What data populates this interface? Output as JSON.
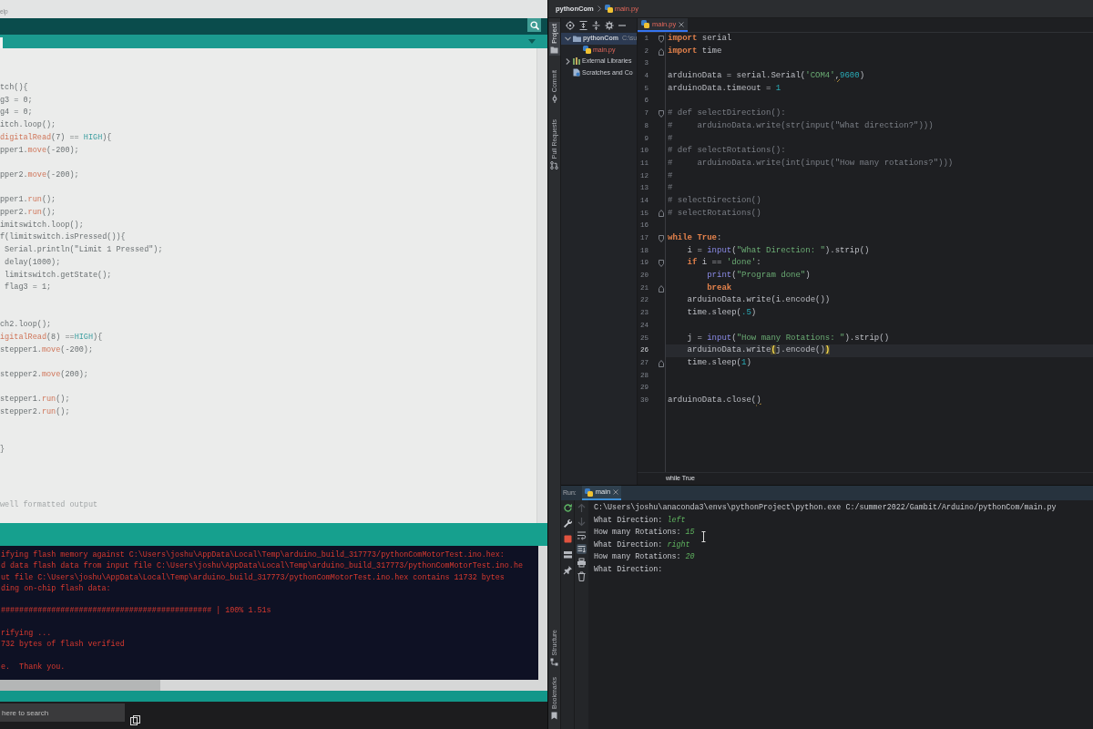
{
  "arduino_ide": {
    "menu": [
      "elp"
    ],
    "code_lines": [
      {
        "kind": "code",
        "tokens": [
          {
            "text": "tch(){",
            "kind": "plain"
          }
        ]
      },
      {
        "kind": "code",
        "tokens": [
          {
            "text": "g3 = 0;",
            "kind": "plain"
          }
        ]
      },
      {
        "kind": "code",
        "tokens": [
          {
            "text": "g4 = 0;",
            "kind": "plain"
          }
        ]
      },
      {
        "kind": "code",
        "tokens": [
          {
            "text": "itch.loop();",
            "kind": "plain"
          }
        ]
      },
      {
        "kind": "code",
        "tokens": [
          {
            "text": "digitalRead",
            "kind": "function"
          },
          {
            "text": "(7) == ",
            "kind": "plain"
          },
          {
            "text": "HIGH",
            "kind": "constant"
          },
          {
            "text": "){",
            "kind": "plain"
          }
        ]
      },
      {
        "kind": "code",
        "tokens": [
          {
            "text": "pper1.",
            "kind": "plain"
          },
          {
            "text": "move",
            "kind": "function"
          },
          {
            "text": "(-200);",
            "kind": "plain"
          }
        ]
      },
      {
        "kind": "blank"
      },
      {
        "kind": "code",
        "tokens": [
          {
            "text": "pper2.",
            "kind": "plain"
          },
          {
            "text": "move",
            "kind": "function"
          },
          {
            "text": "(-200);",
            "kind": "plain"
          }
        ]
      },
      {
        "kind": "blank"
      },
      {
        "kind": "code",
        "tokens": [
          {
            "text": "pper1.",
            "kind": "plain"
          },
          {
            "text": "run",
            "kind": "function"
          },
          {
            "text": "();",
            "kind": "plain"
          }
        ]
      },
      {
        "kind": "code",
        "tokens": [
          {
            "text": "pper2.",
            "kind": "plain"
          },
          {
            "text": "run",
            "kind": "function"
          },
          {
            "text": "();",
            "kind": "plain"
          }
        ]
      },
      {
        "kind": "code",
        "tokens": [
          {
            "text": "imitswitch.loop();",
            "kind": "plain"
          }
        ]
      },
      {
        "kind": "code",
        "tokens": [
          {
            "text": "f(limitswitch.isPressed()){",
            "kind": "plain"
          }
        ]
      },
      {
        "kind": "code",
        "tokens": [
          {
            "text": " Serial.println(\"Limit 1 Pressed\");",
            "kind": "plain"
          }
        ]
      },
      {
        "kind": "code",
        "tokens": [
          {
            "text": " delay(1000);",
            "kind": "plain"
          }
        ]
      },
      {
        "kind": "code",
        "tokens": [
          {
            "text": " limitswitch.getState();",
            "kind": "plain"
          }
        ]
      },
      {
        "kind": "code",
        "tokens": [
          {
            "text": " flag3 = 1;",
            "kind": "plain"
          }
        ]
      },
      {
        "kind": "blank"
      },
      {
        "kind": "blank"
      },
      {
        "kind": "code",
        "tokens": [
          {
            "text": "ch2.loop();",
            "kind": "plain"
          }
        ]
      },
      {
        "kind": "code",
        "tokens": [
          {
            "text": "igitalRead",
            "kind": "function"
          },
          {
            "text": "(8) ==",
            "kind": "plain"
          },
          {
            "text": "HIGH",
            "kind": "constant"
          },
          {
            "text": "){",
            "kind": "plain"
          }
        ]
      },
      {
        "kind": "code",
        "tokens": [
          {
            "text": "stepper1.",
            "kind": "plain"
          },
          {
            "text": "move",
            "kind": "function"
          },
          {
            "text": "(-200);",
            "kind": "plain"
          }
        ]
      },
      {
        "kind": "blank"
      },
      {
        "kind": "code",
        "tokens": [
          {
            "text": "stepper2.",
            "kind": "plain"
          },
          {
            "text": "move",
            "kind": "function"
          },
          {
            "text": "(200);",
            "kind": "plain"
          }
        ]
      },
      {
        "kind": "blank"
      },
      {
        "kind": "code",
        "tokens": [
          {
            "text": "stepper1.",
            "kind": "plain"
          },
          {
            "text": "run",
            "kind": "function"
          },
          {
            "text": "();",
            "kind": "plain"
          }
        ]
      },
      {
        "kind": "code",
        "tokens": [
          {
            "text": "stepper2.",
            "kind": "plain"
          },
          {
            "text": "run",
            "kind": "function"
          },
          {
            "text": "();",
            "kind": "plain"
          }
        ]
      },
      {
        "kind": "blank"
      },
      {
        "kind": "blank"
      },
      {
        "kind": "code",
        "tokens": [
          {
            "text": "}",
            "kind": "plain"
          }
        ]
      }
    ],
    "message": "well formatted output",
    "console_lines": [
      {
        "kind": "text",
        "text": "ifying flash memory against C:\\Users\\joshu\\AppData\\Local\\Temp\\arduino_build_317773/pythonComMotorTest.ino.hex:"
      },
      {
        "kind": "text",
        "text": "d data flash data from input file C:\\Users\\joshu\\AppData\\Local\\Temp\\arduino_build_317773/pythonComMotorTest.ino.he"
      },
      {
        "kind": "text",
        "text": "ut file C:\\Users\\joshu\\AppData\\Local\\Temp\\arduino_build_317773/pythonComMotorTest.ino.hex contains 11732 bytes"
      },
      {
        "kind": "text",
        "text": "ding on-chip flash data:"
      },
      {
        "kind": "blank"
      },
      {
        "kind": "text",
        "text": "############################################## | 100% 1.51s"
      },
      {
        "kind": "blank"
      },
      {
        "kind": "text",
        "text": "rifying ..."
      },
      {
        "kind": "text",
        "text": "732 bytes of flash verified"
      },
      {
        "kind": "blank"
      },
      {
        "kind": "text",
        "text": "e.  Thank you."
      }
    ]
  },
  "taskbar": {
    "search": {
      "placeholder": "here to search"
    }
  },
  "pycharm": {
    "breadcrumbs": [
      {
        "label": "pythonCom",
        "kind": "project"
      },
      {
        "label": "main.py",
        "kind": "python_file",
        "unversioned": true
      }
    ],
    "tool_stripe_top": [
      {
        "label": "Project",
        "selected": true
      },
      {
        "label": "Commit",
        "selected": false
      },
      {
        "label": "Pull Requests",
        "selected": false
      }
    ],
    "tool_stripe_bottom": [
      {
        "label": "Structure",
        "selected": false
      },
      {
        "label": "Bookmarks",
        "selected": false
      }
    ],
    "project_tree": [
      {
        "label": "pythonCom",
        "hint": "C:\\su",
        "kind": "folder",
        "expanded": true,
        "selected": true,
        "children": [
          {
            "label": "main.py",
            "kind": "python_file",
            "unversioned": true,
            "selected": false
          }
        ]
      },
      {
        "label": "External Libraries",
        "kind": "library",
        "expanded": false,
        "selected": false
      },
      {
        "label": "Scratches and Co",
        "kind": "scratches",
        "selected": false
      }
    ],
    "editor": {
      "tabs": [
        {
          "label": "main.py",
          "selected": true,
          "unversioned": true
        }
      ],
      "lines": [
        {
          "number": "1",
          "current": false,
          "kind": "fold_start",
          "tokens": [
            {
              "text": "import",
              "kind": "keyword"
            },
            {
              "text": " serial",
              "kind": "plain"
            }
          ]
        },
        {
          "number": "2",
          "current": false,
          "kind": "fold_end",
          "tokens": [
            {
              "text": "import",
              "kind": "keyword"
            },
            {
              "text": " time",
              "kind": "plain"
            }
          ]
        },
        {
          "number": "3",
          "current": false,
          "kind": "plain"
        },
        {
          "number": "4",
          "current": false,
          "kind": "plain",
          "tokens": [
            {
              "text": "arduinoData = serial.Serial(",
              "kind": "plain"
            },
            {
              "text": "'COM4'",
              "kind": "string"
            },
            {
              "text": ",",
              "kind": "warn"
            },
            {
              "text": "9600",
              "kind": "number"
            },
            {
              "text": ")",
              "kind": "plain"
            }
          ]
        },
        {
          "number": "5",
          "current": false,
          "kind": "plain",
          "tokens": [
            {
              "text": "arduinoData.timeout = ",
              "kind": "plain"
            },
            {
              "text": "1",
              "kind": "number"
            }
          ]
        },
        {
          "number": "6",
          "current": false,
          "kind": "plain"
        },
        {
          "number": "7",
          "current": false,
          "kind": "fold_start",
          "tokens": [
            {
              "text": "# def selectDirection():",
              "kind": "comment"
            }
          ]
        },
        {
          "number": "8",
          "current": false,
          "kind": "plain",
          "tokens": [
            {
              "text": "#     arduinoData.write(str(input(\"What direction?\")))",
              "kind": "comment"
            }
          ]
        },
        {
          "number": "9",
          "current": false,
          "kind": "plain",
          "tokens": [
            {
              "text": "#",
              "kind": "comment"
            }
          ]
        },
        {
          "number": "10",
          "current": false,
          "kind": "plain",
          "tokens": [
            {
              "text": "# def selectRotations():",
              "kind": "comment"
            }
          ]
        },
        {
          "number": "11",
          "current": false,
          "kind": "plain",
          "tokens": [
            {
              "text": "#     arduinoData.write(int(input(\"How many rotations?\")))",
              "kind": "comment"
            }
          ]
        },
        {
          "number": "12",
          "current": false,
          "kind": "plain",
          "tokens": [
            {
              "text": "#",
              "kind": "comment"
            }
          ]
        },
        {
          "number": "13",
          "current": false,
          "kind": "plain",
          "tokens": [
            {
              "text": "#",
              "kind": "comment"
            }
          ]
        },
        {
          "number": "14",
          "current": false,
          "kind": "plain",
          "tokens": [
            {
              "text": "# selectDirection()",
              "kind": "comment"
            }
          ]
        },
        {
          "number": "15",
          "current": false,
          "kind": "fold_end",
          "tokens": [
            {
              "text": "# selectRotations()",
              "kind": "comment"
            }
          ]
        },
        {
          "number": "16",
          "current": false,
          "kind": "plain"
        },
        {
          "number": "17",
          "current": false,
          "kind": "fold_start",
          "tokens": [
            {
              "text": "while True",
              "kind": "keyword"
            },
            {
              "text": ":",
              "kind": "plain"
            }
          ]
        },
        {
          "number": "18",
          "current": false,
          "kind": "plain",
          "tokens": [
            {
              "text": "    i = ",
              "kind": "plain"
            },
            {
              "text": "input",
              "kind": "builtin"
            },
            {
              "text": "(",
              "kind": "plain"
            },
            {
              "text": "\"What Direction: \"",
              "kind": "string"
            },
            {
              "text": ").strip()",
              "kind": "plain"
            }
          ]
        },
        {
          "number": "19",
          "current": false,
          "kind": "fold_start",
          "tokens": [
            {
              "text": "    if",
              "kind": "keyword"
            },
            {
              "text": " i == ",
              "kind": "plain"
            },
            {
              "text": "'done'",
              "kind": "string"
            },
            {
              "text": ":",
              "kind": "plain"
            }
          ]
        },
        {
          "number": "20",
          "current": false,
          "kind": "plain",
          "tokens": [
            {
              "text": "        print",
              "kind": "builtin"
            },
            {
              "text": "(",
              "kind": "plain"
            },
            {
              "text": "\"Program done\"",
              "kind": "string"
            },
            {
              "text": ")",
              "kind": "plain"
            }
          ]
        },
        {
          "number": "21",
          "current": false,
          "kind": "fold_end",
          "tokens": [
            {
              "text": "        break",
              "kind": "keyword"
            }
          ]
        },
        {
          "number": "22",
          "current": false,
          "kind": "plain",
          "tokens": [
            {
              "text": "    arduinoData.write(i.encode())",
              "kind": "plain"
            }
          ]
        },
        {
          "number": "23",
          "current": false,
          "kind": "plain",
          "tokens": [
            {
              "text": "    time.sleep(",
              "kind": "plain"
            },
            {
              "text": ".5",
              "kind": "number"
            },
            {
              "text": ")",
              "kind": "plain"
            }
          ]
        },
        {
          "number": "24",
          "current": false,
          "kind": "plain"
        },
        {
          "number": "25",
          "current": false,
          "kind": "plain",
          "tokens": [
            {
              "text": "    j = ",
              "kind": "plain"
            },
            {
              "text": "input",
              "kind": "builtin"
            },
            {
              "text": "(",
              "kind": "plain"
            },
            {
              "text": "\"How many Rotations: \"",
              "kind": "string"
            },
            {
              "text": ").strip()",
              "kind": "plain"
            }
          ]
        },
        {
          "number": "26",
          "current": true,
          "kind": "plain",
          "tokens": [
            {
              "text": "    arduinoData.write",
              "kind": "plain"
            },
            {
              "text": "(",
              "kind": "match"
            },
            {
              "text": "j.encode()",
              "kind": "plain"
            },
            {
              "text": ")",
              "kind": "match"
            }
          ]
        },
        {
          "number": "27",
          "current": false,
          "kind": "fold_end",
          "tokens": [
            {
              "text": "    time.sleep(",
              "kind": "plain"
            },
            {
              "text": "1",
              "kind": "number"
            },
            {
              "text": ")",
              "kind": "plain"
            }
          ]
        },
        {
          "number": "28",
          "current": false,
          "kind": "plain"
        },
        {
          "number": "29",
          "current": false,
          "kind": "plain"
        },
        {
          "number": "30",
          "current": false,
          "kind": "plain",
          "tokens": [
            {
              "text": "arduinoData.close(",
              "kind": "plain"
            },
            {
              "text": ")",
              "kind": "warn"
            }
          ]
        }
      ],
      "breadcrumb": "while True"
    },
    "run": {
      "label": "Run:",
      "tabs": [
        {
          "label": "main",
          "selected": true
        }
      ],
      "left_toolbar": [
        {
          "disabled": false,
          "on": false
        },
        {
          "disabled": false,
          "on": false
        },
        {
          "disabled": false,
          "on": false
        },
        {
          "disabled": false,
          "on": false
        },
        {
          "disabled": false,
          "on": false
        }
      ],
      "right_toolbar": [
        {
          "disabled": true,
          "on": false
        },
        {
          "disabled": true,
          "on": false
        },
        {
          "disabled": false,
          "on": false
        },
        {
          "disabled": false,
          "on": true
        },
        {
          "disabled": false,
          "on": false
        },
        {
          "disabled": false,
          "on": false
        }
      ],
      "console": [
        {
          "segments": [
            {
              "text": "C:\\Users\\joshu\\anaconda3\\envs\\pythonProject\\python.exe C:/summer2022/Gambit/Arduino/pythonCom/main.py",
              "kind": "output"
            }
          ]
        },
        {
          "segments": [
            {
              "text": "What Direction: ",
              "kind": "output"
            },
            {
              "text": "left",
              "kind": "input"
            }
          ]
        },
        {
          "segments": [
            {
              "text": "How many Rotations: ",
              "kind": "output"
            },
            {
              "text": "15",
              "kind": "input"
            }
          ]
        },
        {
          "segments": [
            {
              "text": "What Direction: ",
              "kind": "output"
            },
            {
              "text": "right",
              "kind": "input"
            }
          ]
        },
        {
          "segments": [
            {
              "text": "How many Rotations: ",
              "kind": "output"
            },
            {
              "text": "20",
              "kind": "input"
            }
          ]
        },
        {
          "segments": [
            {
              "text": "What Direction:",
              "kind": "output"
            }
          ]
        }
      ]
    }
  }
}
